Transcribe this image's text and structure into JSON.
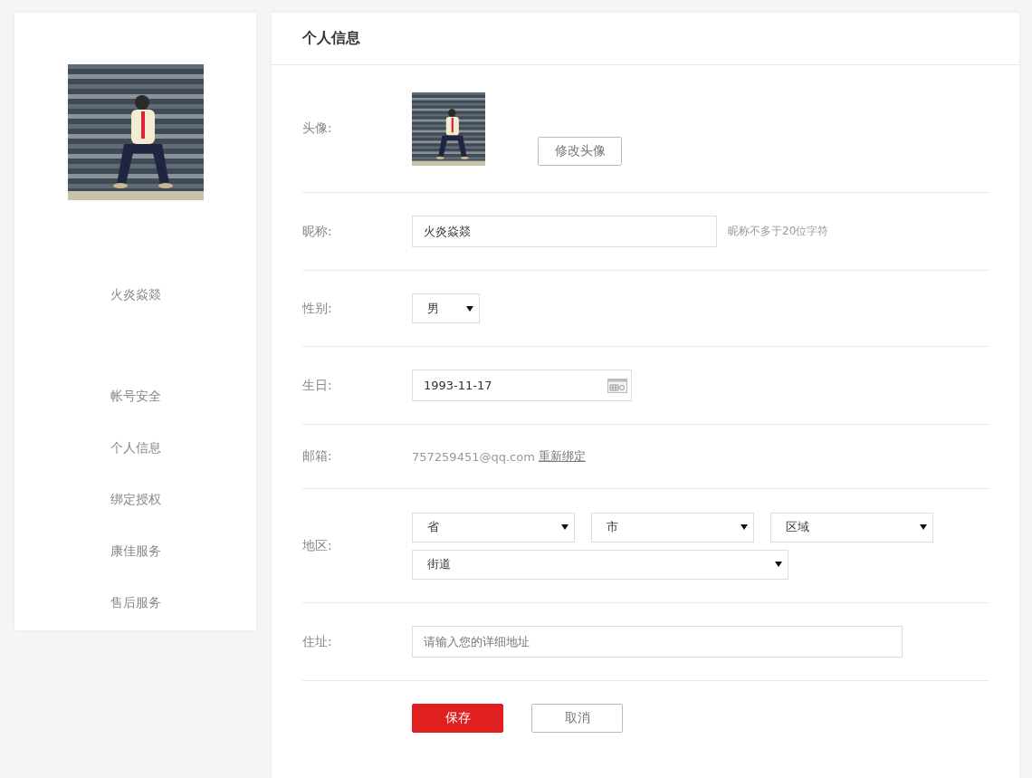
{
  "sidebar": {
    "username": "火炎焱燚",
    "nav": [
      {
        "label": "帐号安全"
      },
      {
        "label": "个人信息"
      },
      {
        "label": "绑定授权"
      },
      {
        "label": "康佳服务"
      },
      {
        "label": "售后服务"
      }
    ]
  },
  "panel": {
    "title": "个人信息"
  },
  "form": {
    "rows": [
      {
        "kind": "avatar",
        "label": "头像:",
        "button": "修改头像"
      },
      {
        "kind": "text",
        "label": "昵称:",
        "value": "火炎焱燚",
        "hint": "昵称不多于20位字符"
      },
      {
        "kind": "select",
        "label": "性别:",
        "selects": [
          {
            "value": "男"
          }
        ]
      },
      {
        "kind": "date",
        "label": "生日:",
        "value": "1993-11-17"
      },
      {
        "kind": "email",
        "label": "邮箱:",
        "value": "757259451@qq.com",
        "link": "重新绑定"
      },
      {
        "kind": "select",
        "label": "地区:",
        "selects": [
          {
            "value": "省"
          },
          {
            "value": "市"
          },
          {
            "value": "区域"
          },
          {
            "value": "街道"
          }
        ]
      },
      {
        "kind": "address",
        "label": "住址:",
        "placeholder": "请输入您的详细地址"
      }
    ],
    "buttons": [
      {
        "label": "保存",
        "kind": "primary"
      },
      {
        "label": "取消",
        "kind": "secondary"
      }
    ]
  }
}
